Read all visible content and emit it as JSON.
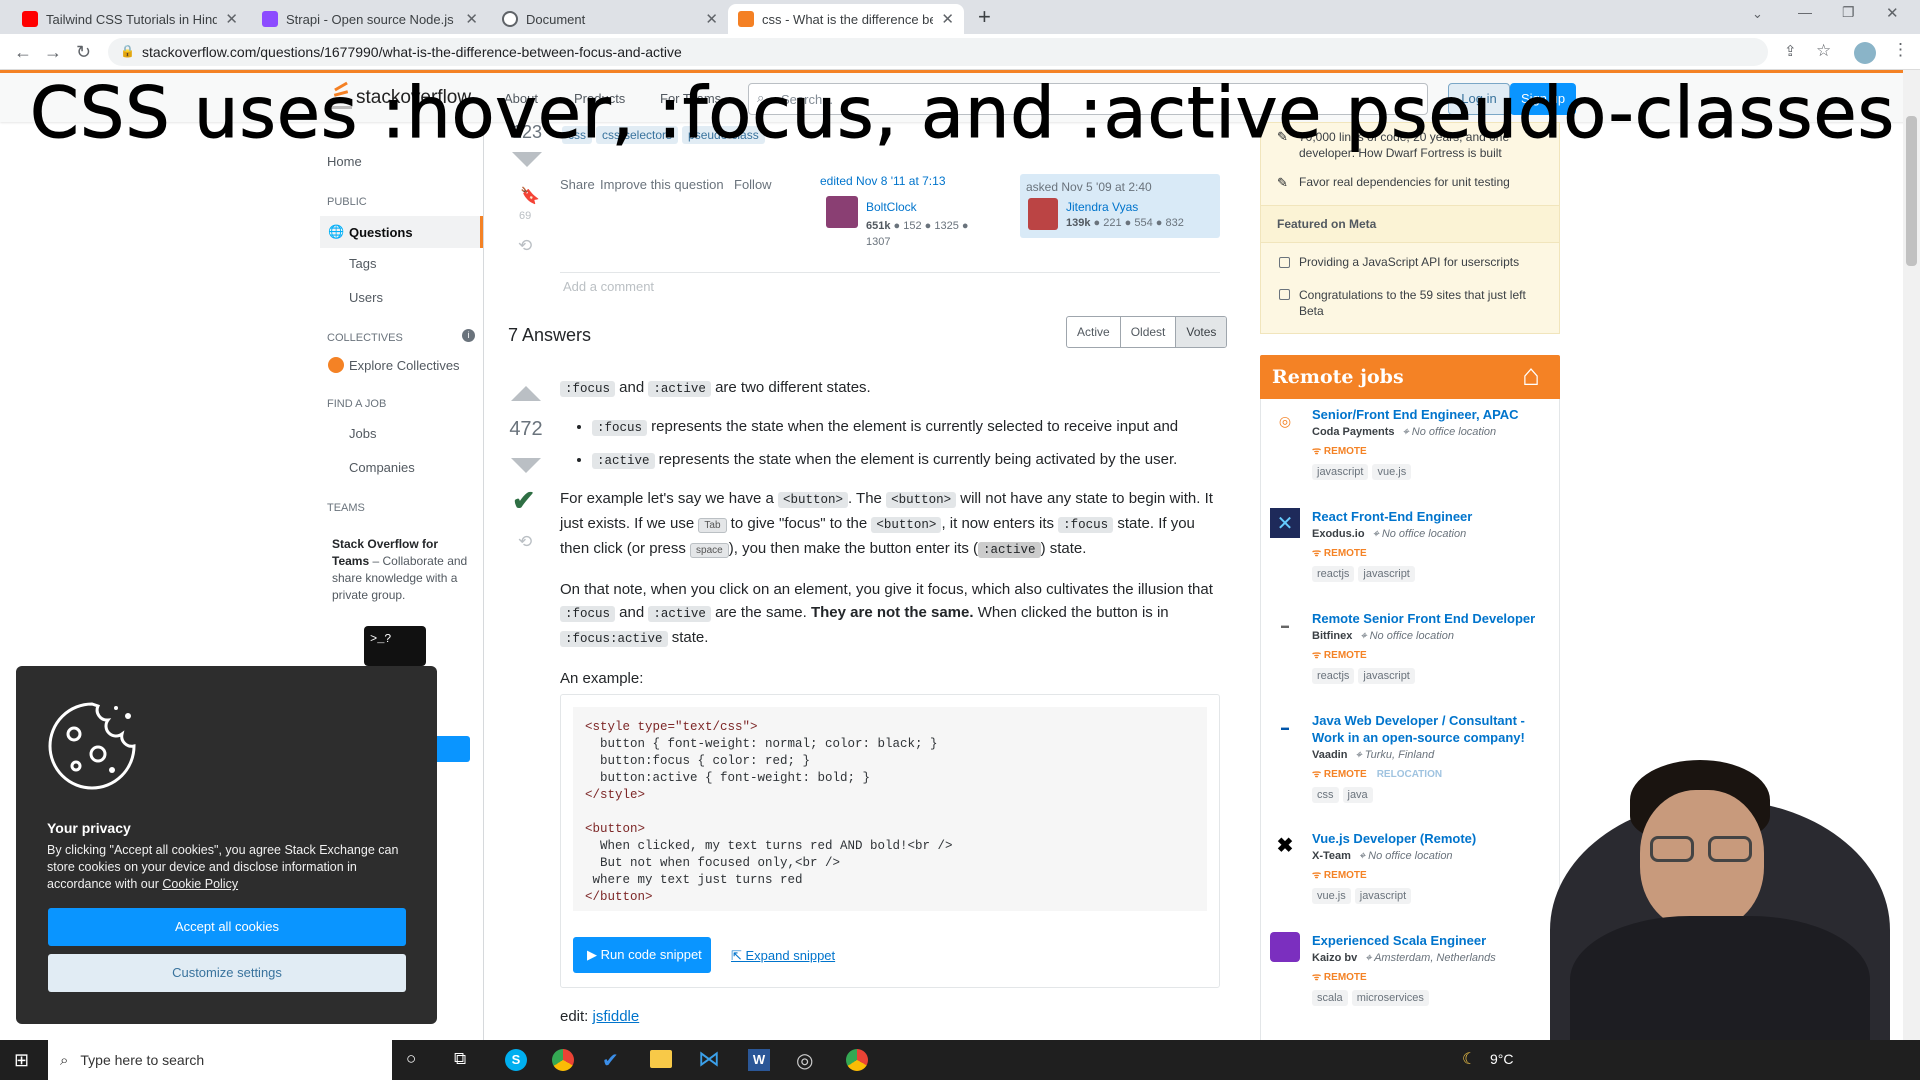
{
  "browser": {
    "tabs": [
      {
        "title": "Tailwind CSS Tutorials in Hindi - Y",
        "fav": "#ff0000"
      },
      {
        "title": "Strapi - Open source Node.js He",
        "fav": "#8c4bff"
      },
      {
        "title": "Document",
        "fav": "#5f6368"
      },
      {
        "title": "css - What is the difference betw",
        "fav": "#f48024"
      }
    ],
    "url": "stackoverflow.com/questions/1677990/what-is-the-difference-between-focus-and-active"
  },
  "caption": "CSS uses :hover, :focus, and :active pseudo-classes",
  "so_header": {
    "logo": "stackoverflow",
    "about": "About",
    "products": "Products",
    "teams": "For Teams",
    "search_placeholder": "Search...",
    "login": "Log in",
    "signup": "Sign up"
  },
  "sidebar": {
    "home": "Home",
    "public": "PUBLIC",
    "questions": "Questions",
    "tags": "Tags",
    "users": "Users",
    "collectives": "COLLECTIVES",
    "explore": "Explore Collectives",
    "findjob": "FIND A JOB",
    "jobs": "Jobs",
    "companies": "Companies",
    "teams": "TEAMS",
    "teams_title": "Stack Overflow for Teams",
    "teams_desc": " – Collaborate and share knowledge with a private group."
  },
  "question": {
    "vote_partial": "123",
    "tags": [
      "css",
      "css-selectors",
      "pseudo-class"
    ],
    "bookmarks": "69",
    "share": "Share",
    "improve": "Improve this question",
    "follow": "Follow",
    "edited": "edited Nov 8 '11 at 7:13",
    "editor": "BoltClock",
    "editor_rep": "651k",
    "editor_badges": "● 152 ● 1325 ● 1307",
    "asked": "asked Nov 5 '09 at 2:40",
    "asker": "Jitendra Vyas",
    "asker_rep": "139k",
    "asker_badges": "● 221 ● 554 ● 832",
    "add_comment": "Add a comment"
  },
  "answers": {
    "count": "7 Answers",
    "sort": [
      "Active",
      "Oldest",
      "Votes"
    ],
    "votes": "472",
    "p1_c1": ":focus",
    "p1_and": " and ",
    "p1_c2": ":active",
    "p1_rest": " are two different states.",
    "b1_code": ":focus",
    "b1_text": " represents the state when the element is currently selected to receive input and",
    "b2_code": ":active",
    "b2_text": " represents the state when the element is currently being activated by the user.",
    "p2_a": "For example let's say we have a ",
    "p2_b": "<button>",
    "p2_c": ". The ",
    "p2_d": "<button>",
    "p2_e": " will not have any state to begin with. It just exists. If we use ",
    "p2_tab": "Tab",
    "p2_f": " to give \"focus\" to the ",
    "p2_g": "<button>",
    "p2_h": ", it now enters its ",
    "p2_i": ":focus",
    "p2_j": " state. If you then click (or press ",
    "p2_space": "space",
    "p2_k": "), you then make the button enter its (",
    "p2_l": ":active",
    "p2_m": ") state.",
    "p3_a": "On that note, when you click on an element, you give it focus, which also cultivates the illusion that ",
    "p3_b": ":focus",
    "p3_c": " and ",
    "p3_d": ":active",
    "p3_e": " are the same. ",
    "p3_bold": "They are not the same.",
    "p3_f": " When clicked the button is in ",
    "p3_g": ":focus:active",
    "p3_h": " state.",
    "example": "An example:",
    "code_lines": [
      "<style type=\"text/css\">",
      "  button { font-weight: normal; color: black; }",
      "  button:focus { color: red; }",
      "  button:active { font-weight: bold; }",
      "</style>",
      "",
      "<button>",
      "  When clicked, my text turns red AND bold!<br />",
      "  But not when focused only,<br />",
      " where my text just turns red",
      "</button>"
    ],
    "run": "Run code snippet",
    "expand": "Expand snippet",
    "edit": "edit: ",
    "jsfiddle": "jsfiddle"
  },
  "right": {
    "blog_1": "70,000 lines of code, 20 years, and one developer: How Dwarf Fortress is built",
    "blog_2": "Favor real dependencies for unit testing",
    "meta_head": "Featured on Meta",
    "meta_1": "Providing a JavaScript API for userscripts",
    "meta_2": "Congratulations to the 59 sites that just left Beta",
    "jobs_title": "Remote jobs",
    "jobs": [
      {
        "title": "Senior/Front End Engineer, APAC",
        "company": "Coda Payments",
        "loc": "No office location",
        "remote": "REMOTE",
        "extra": "",
        "tags": [
          "javascript",
          "vue.js"
        ]
      },
      {
        "title": "React Front-End Engineer",
        "company": "Exodus.io",
        "loc": "No office location",
        "remote": "REMOTE",
        "extra": "",
        "tags": [
          "reactjs",
          "javascript"
        ]
      },
      {
        "title": "Remote Senior Front End Developer",
        "company": "Bitfinex",
        "loc": "No office location",
        "remote": "REMOTE",
        "extra": "",
        "tags": [
          "reactjs",
          "javascript"
        ]
      },
      {
        "title": "Java Web Developer / Consultant - Work in an open-source company!",
        "company": "Vaadin",
        "loc": "Turku, Finland",
        "remote": "REMOTE",
        "extra": "RELOCATION",
        "tags": [
          "css",
          "java"
        ]
      },
      {
        "title": "Vue.js Developer (Remote)",
        "company": "X-Team",
        "loc": "No office location",
        "remote": "REMOTE",
        "extra": "",
        "tags": [
          "vue.js",
          "javascript"
        ]
      },
      {
        "title": "Experienced Scala Engineer",
        "company": "Kaizo bv",
        "loc": "Amsterdam, Netherlands",
        "remote": "REMOTE",
        "extra": "",
        "tags": [
          "scala",
          "microservices"
        ]
      }
    ]
  },
  "cookie": {
    "title": "Your privacy",
    "text": "By clicking \"Accept all cookies\", you agree Stack Exchange can store cookies on your device and disclose information in accordance with our ",
    "link": "Cookie Policy",
    "accept": "Accept all cookies",
    "customize": "Customize settings"
  },
  "taskbar": {
    "search": "Type here to search",
    "temp": "9°C"
  }
}
